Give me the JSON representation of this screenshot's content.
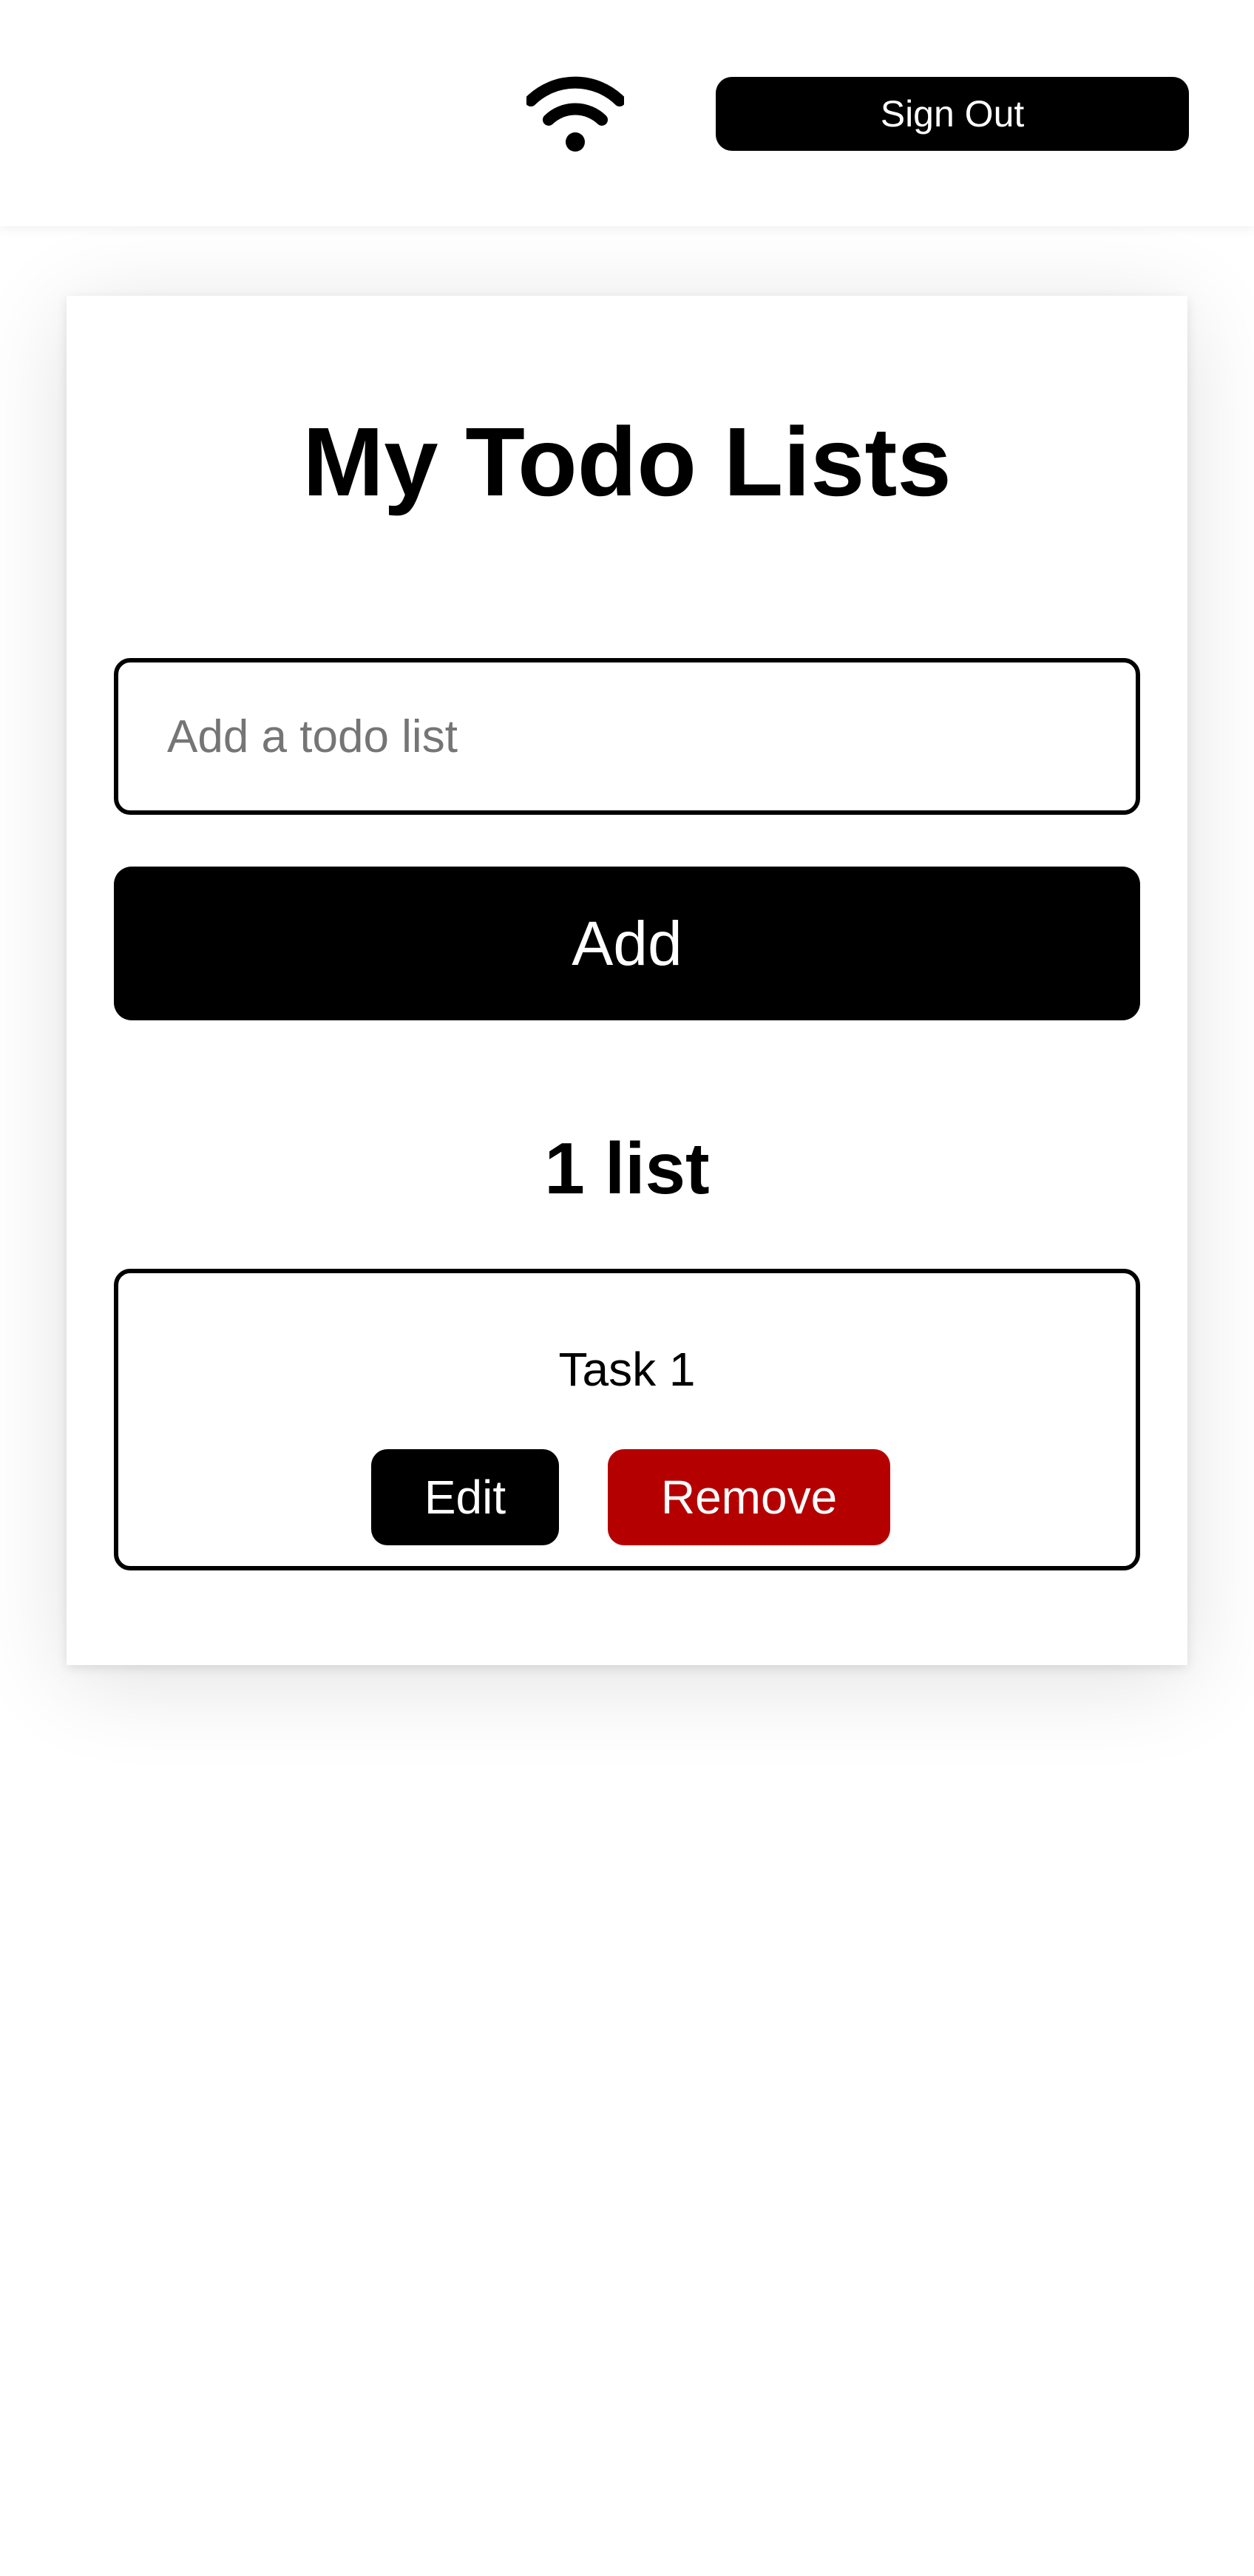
{
  "header": {
    "wifi_icon": "wifi-icon",
    "sign_out_label": "Sign Out"
  },
  "main": {
    "title": "My Todo Lists",
    "input": {
      "placeholder": "Add a todo list",
      "value": ""
    },
    "add_label": "Add",
    "count_label": "1 list",
    "lists": [
      {
        "name": "Task 1",
        "edit_label": "Edit",
        "remove_label": "Remove"
      }
    ]
  },
  "colors": {
    "primary": "#000000",
    "danger": "#b50000",
    "background": "#ffffff",
    "placeholder": "#757575"
  }
}
